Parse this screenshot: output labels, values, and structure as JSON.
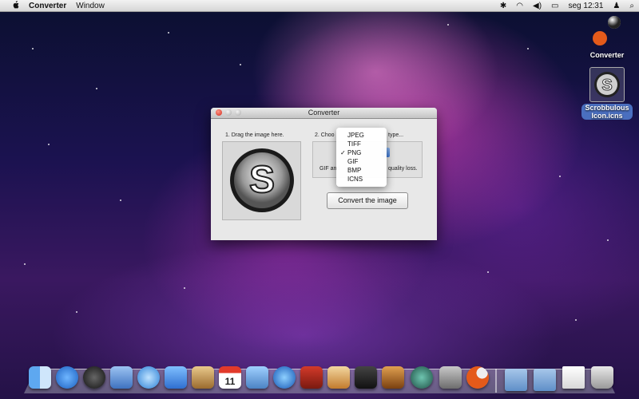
{
  "menubar": {
    "apple": "",
    "app_name": "Converter",
    "menus": [
      "Window"
    ],
    "status": {
      "bluetooth": "✱",
      "wifi": "◠",
      "sound": "◀)",
      "battery": "▭",
      "clock": "seg 12:31",
      "user": "♟",
      "search": "⌕"
    }
  },
  "desktop": {
    "icons": [
      {
        "label": "Converter"
      },
      {
        "label": "Scrobbulous Icon.icns"
      }
    ]
  },
  "window": {
    "title": "Converter",
    "drag_label": "1. Drag the image here.",
    "choose_label_left": "2. Choo",
    "choose_label_right": "type...",
    "note_left": "GIF and",
    "note_right": "quality loss.",
    "convert_button": "Convert the image"
  },
  "format_menu": {
    "selected": "PNG",
    "options": [
      {
        "label": "JPEG",
        "checked": false
      },
      {
        "label": "TIFF",
        "checked": false
      },
      {
        "label": "PNG",
        "checked": true
      },
      {
        "label": "GIF",
        "checked": false
      },
      {
        "label": "BMP",
        "checked": false
      },
      {
        "label": "ICNS",
        "checked": false
      }
    ],
    "check_mark": "✓"
  },
  "dock": {
    "calendar_day": "11",
    "items": [
      "Finder",
      "App Store",
      "Dashboard",
      "Mail",
      "Safari",
      "FaceTime",
      "Address Book",
      "iCal",
      "iPhoto",
      "iTunes",
      "Photo Booth",
      "Preview",
      "iMovie",
      "GarageBand",
      "Time Machine",
      "System Preferences",
      "Converter",
      "Applications",
      "Documents",
      "Downloads",
      "Trash"
    ]
  }
}
